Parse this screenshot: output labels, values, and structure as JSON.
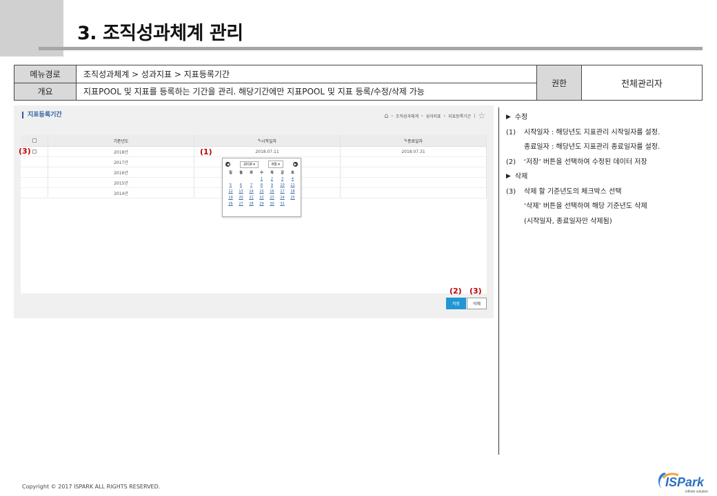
{
  "page": {
    "title": "3. 조직성과체계 관리"
  },
  "info": {
    "menu_label": "메뉴경로",
    "menu_value": "조직성과체계 > 성과지표 > 지표등록기간",
    "overview_label": "개요",
    "overview_value": "지표POOL 및 지표를 등록하는 기간을 관리. 해당기간에만 지표POOL 및 지표 등록/수정/삭제 가능",
    "auth_label": "권한",
    "auth_value": "전체관리자"
  },
  "screenshot": {
    "title": "지표등록기간",
    "breadcrumb": [
      "조직성과체계",
      "성과지표",
      "지표등록기간"
    ],
    "columns": [
      "기준년도",
      "시작일자",
      "종료일자"
    ],
    "rows": [
      {
        "year": "2018년",
        "start": "2018.07.11",
        "end": "2018.07.31"
      },
      {
        "year": "2017년",
        "start": "",
        "end": ""
      },
      {
        "year": "2016년",
        "start": "",
        "end": ""
      },
      {
        "year": "2015년",
        "start": "",
        "end": ""
      },
      {
        "year": "2014년",
        "start": "",
        "end": ""
      }
    ],
    "calendar": {
      "year": "2018",
      "month": "8월",
      "weekdays": [
        "일",
        "월",
        "화",
        "수",
        "목",
        "금",
        "토"
      ],
      "weeks": [
        [
          "",
          "",
          "",
          "1",
          "2",
          "3",
          "4"
        ],
        [
          "5",
          "6",
          "7",
          "8",
          "9",
          "10",
          "11"
        ],
        [
          "12",
          "13",
          "14",
          "15",
          "16",
          "17",
          "18"
        ],
        [
          "19",
          "20",
          "21",
          "22",
          "23",
          "24",
          "25"
        ],
        [
          "26",
          "27",
          "28",
          "29",
          "30",
          "31",
          ""
        ]
      ]
    },
    "save_label": "저장",
    "delete_label": "삭제",
    "marks": {
      "m1": "(1)",
      "m2": "(2)",
      "m3": "(3)"
    }
  },
  "notes": {
    "edit_head": "수정",
    "edit_1_num": "(1)",
    "edit_1_a": "시작일자 : 해당년도 지표관리 시작일자를 설정.",
    "edit_1_b": "종료일자 : 해당년도 지표관리 종료일자를 설정.",
    "edit_2_num": "(2)",
    "edit_2": "‘저장’ 버튼을 선택하여 수정된 데이터 저장",
    "delete_head": "삭제",
    "delete_3_num": "(3)",
    "delete_3_a": "삭제 할 기준년도의 체크박스 선택",
    "delete_3_b": "‘삭제’ 버튼을 선택하여 해당 기준년도 삭제",
    "delete_3_c": "(시작일자, 종료일자만 삭제됨)"
  },
  "footer": {
    "copyright": "Copyright © 2017 ISPARK ALL RIGHTS RESERVED.",
    "logo_text": "ISPark",
    "logo_tagline": "infinite solution"
  }
}
